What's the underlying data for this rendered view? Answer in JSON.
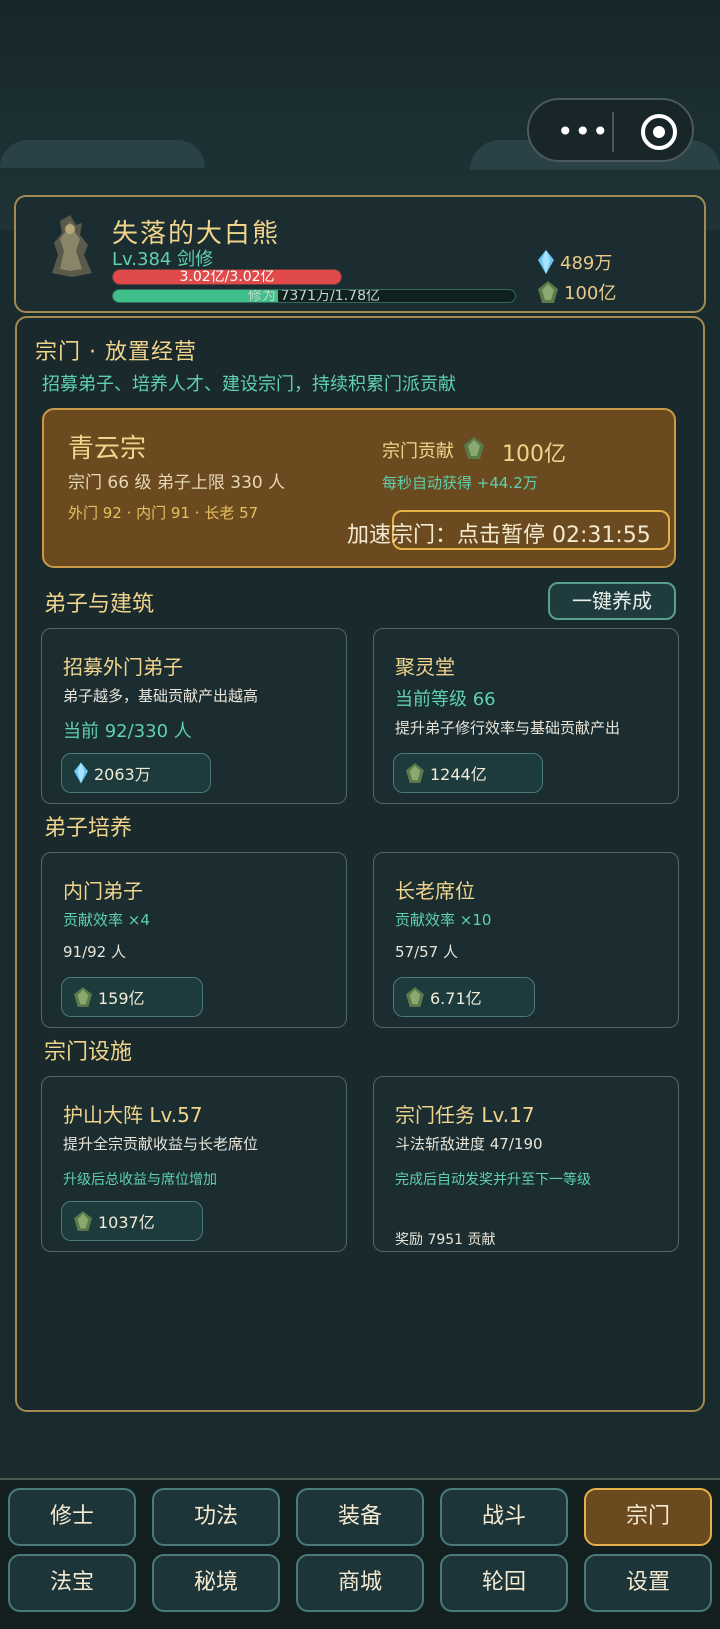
{
  "player": {
    "name": "失落的大白熊",
    "level": "Lv.384 剑修",
    "hp_text": "3.02亿/3.02亿",
    "hp_fraction": 1.0,
    "exp_text": "修为 7371万/1.78亿",
    "exp_fraction": 0.41,
    "currency_crystal": "489万",
    "currency_stone": "100亿"
  },
  "panel": {
    "title": "宗门 · 放置经营",
    "subtitle": "招募弟子、培养人才、建设宗门，持续积累门派贡献"
  },
  "sect": {
    "name": "青云宗",
    "level_text": "宗门 66 级  弟子上限 330 人",
    "ranks": "外门 92 · 内门 91 · 长老 57",
    "contribution_label": "宗门贡献",
    "contribution_value": "100亿",
    "rate": "每秒自动获得 +44.2万",
    "speed_button": "加速宗门：点击暂停 02:31:55"
  },
  "groups": {
    "disciples_buildings": "弟子与建筑",
    "one_key": "一键养成",
    "training": "弟子培养",
    "facilities": "宗门设施"
  },
  "cards": {
    "recruit": {
      "title": "招募外门弟子",
      "desc": "弟子越多，基础贡献产出越高",
      "current": "当前 92/330 人",
      "cost": "2063万",
      "cost_icon": "crystal-icon"
    },
    "hall": {
      "title": "聚灵堂",
      "current": "当前等级 66",
      "desc": "提升弟子修行效率与基础贡献产出",
      "cost": "1244亿",
      "cost_icon": "stone-icon"
    },
    "inner": {
      "title": "内门弟子",
      "rate": "贡献效率 ×4",
      "count": "91/92 人",
      "cost": "159亿",
      "cost_icon": "stone-icon"
    },
    "elder": {
      "title": "长老席位",
      "rate": "贡献效率 ×10",
      "count": "57/57 人",
      "cost": "6.71亿",
      "cost_icon": "stone-icon"
    },
    "array": {
      "title": "护山大阵 Lv.57",
      "desc": "提升全宗贡献收益与长老席位",
      "note": "升级后总收益与席位增加",
      "cost": "1037亿",
      "cost_icon": "stone-icon"
    },
    "mission": {
      "title": "宗门任务 Lv.17",
      "progress": "斗法斩敌进度 47/190",
      "note": "完成后自动发奖并升至下一等级",
      "reward": "奖励 7951 贡献"
    }
  },
  "nav": {
    "row1": [
      "修士",
      "功法",
      "装备",
      "战斗",
      "宗门"
    ],
    "row2": [
      "法宝",
      "秘境",
      "商城",
      "轮回",
      "设置"
    ],
    "active": "宗门"
  },
  "colors": {
    "gold": "#f0d48c",
    "teal": "#5fd0b0",
    "panel_border": "#a38a52",
    "sect_bg": "#6a4a1e",
    "hp": "#e04a4a",
    "exp": "#3fbf8a"
  }
}
